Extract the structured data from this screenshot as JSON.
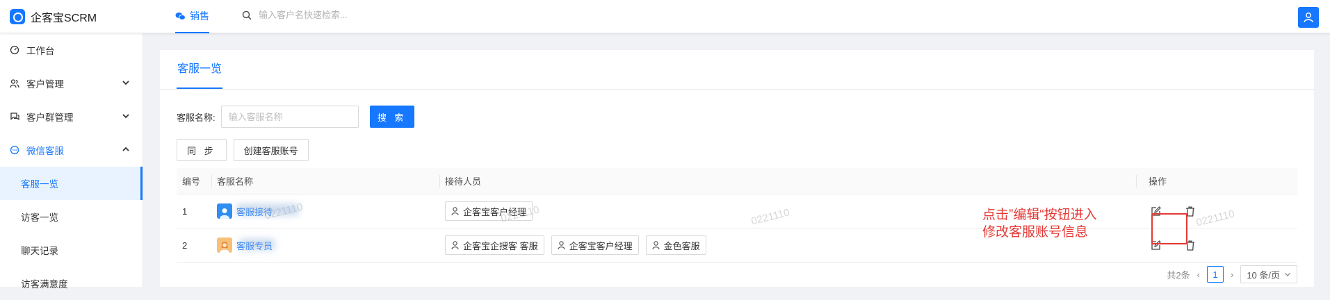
{
  "app": {
    "title": "企客宝SCRM",
    "top_tab_label": "销售",
    "search_placeholder": "输入客户名快速检索..."
  },
  "sidebar": {
    "items": [
      {
        "label": "工作台",
        "icon": "dashboard-icon"
      },
      {
        "label": "客户管理",
        "icon": "users-icon",
        "expanded": false
      },
      {
        "label": "客户群管理",
        "icon": "chat-group-icon",
        "expanded": false
      },
      {
        "label": "微信客服",
        "icon": "message-icon",
        "expanded": true,
        "active": true
      }
    ],
    "sub_items": [
      {
        "label": "客服一览",
        "active": true
      },
      {
        "label": "访客一览"
      },
      {
        "label": "聊天记录"
      },
      {
        "label": "访客满意度"
      }
    ]
  },
  "page": {
    "tab_label": "客服一览",
    "filter_label": "客服名称:",
    "filter_placeholder": "输入客服名称",
    "search_button": "搜 索",
    "sync_button": "同 步",
    "create_button": "创建客服账号"
  },
  "table": {
    "headers": {
      "id": "编号",
      "name": "客服名称",
      "receptionists": "接待人员",
      "actions": "操作"
    },
    "rows": [
      {
        "id": "1",
        "name": "客服接待",
        "receptionists": [
          "企客宝客户经理"
        ]
      },
      {
        "id": "2",
        "name": "客服专员",
        "receptionists": [
          "企客宝企搜客 客服",
          "企客宝客户经理",
          "金色客服"
        ]
      }
    ]
  },
  "annotation": {
    "line1": "点击”编辑“按钮进入",
    "line2": "修改客服账号信息"
  },
  "pager": {
    "total": "共2条",
    "current_page": "1",
    "page_size": "10 条/页"
  },
  "watermark": "0221110",
  "colors": {
    "accent": "#1677ff",
    "annotation": "#e53935"
  }
}
